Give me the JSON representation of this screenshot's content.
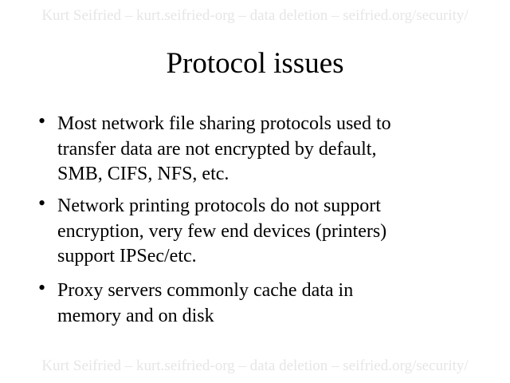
{
  "header": "Kurt Seifried – kurt.seifried-org – data deletion – seifried.org/security/",
  "title": "Protocol issues",
  "bullets": [
    {
      "lines": [
        "Most network file sharing protocols used to",
        "transfer data are not encrypted by default,",
        "SMB, CIFS, NFS, etc."
      ]
    },
    {
      "lines": [
        "Network printing protocols do not support",
        "encryption, very few end devices (printers)",
        "support IPSec/etc."
      ]
    },
    {
      "lines": [
        "Proxy servers commonly cache data in",
        "memory and on disk"
      ]
    }
  ],
  "bullet_glyph": "•",
  "footer": "Kurt Seifried – kurt.seifried-org – data deletion – seifried.org/security/"
}
